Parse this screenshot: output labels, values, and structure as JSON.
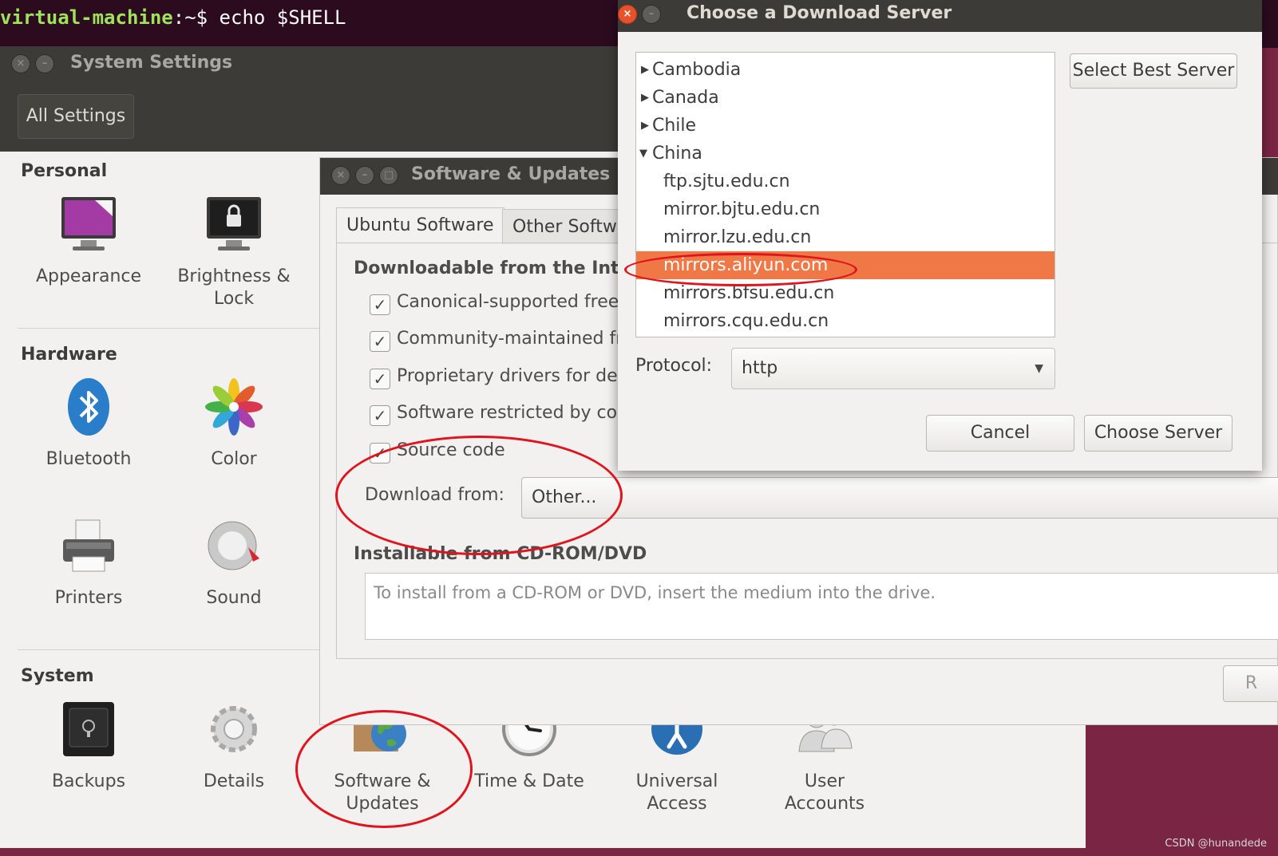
{
  "terminal": {
    "host": "virtual-machine",
    "path": ":~$ ",
    "command": "echo $SHELL"
  },
  "system_settings": {
    "title": "System Settings",
    "all_settings": "All Settings",
    "sections": {
      "personal": "Personal",
      "hardware": "Hardware",
      "system": "System"
    },
    "items": {
      "appearance": "Appearance",
      "brightness_1": "Brightness &",
      "brightness_2": "Lock",
      "bluetooth": "Bluetooth",
      "color": "Color",
      "printers": "Printers",
      "sound": "Sound",
      "backups": "Backups",
      "details": "Details",
      "software_1": "Software &",
      "software_2": "Updates",
      "timedate": "Time & Date",
      "ua_1": "Universal",
      "ua_2": "Access",
      "users_1": "User",
      "users_2": "Accounts"
    }
  },
  "software_updates": {
    "title": "Software & Updates",
    "tabs": [
      "Ubuntu Software",
      "Other Softw"
    ],
    "downloadable_heading": "Downloadable from the Inter",
    "checkboxes": [
      "Canonical-supported free",
      "Community-maintained fr",
      "Proprietary drivers for de",
      "Software restricted by co",
      "Source code"
    ],
    "download_from_label": "Download from:",
    "download_from_value": "Other...",
    "cdrom_heading": "Installable from CD-ROM/DVD",
    "cdrom_text": "To install from a CD-ROM or DVD, insert the medium into the drive.",
    "partial_button": "R"
  },
  "download_server": {
    "title": "Choose a Download Server",
    "countries": [
      "Cambodia",
      "Canada",
      "Chile",
      "China"
    ],
    "mirrors": [
      "ftp.sjtu.edu.cn",
      "mirror.bjtu.edu.cn",
      "mirror.lzu.edu.cn",
      "mirrors.aliyun.com",
      "mirrors.bfsu.edu.cn",
      "mirrors.cqu.edu.cn"
    ],
    "selected": "mirrors.aliyun.com",
    "select_best": "Select Best Server",
    "protocol_label": "Protocol:",
    "protocol_value": "http",
    "cancel": "Cancel",
    "choose": "Choose Server"
  },
  "watermark": "CSDN @hunandede",
  "colors": {
    "selection": "#f07746",
    "annotation": "#e0141c",
    "titlebar": "#3c3b37"
  }
}
